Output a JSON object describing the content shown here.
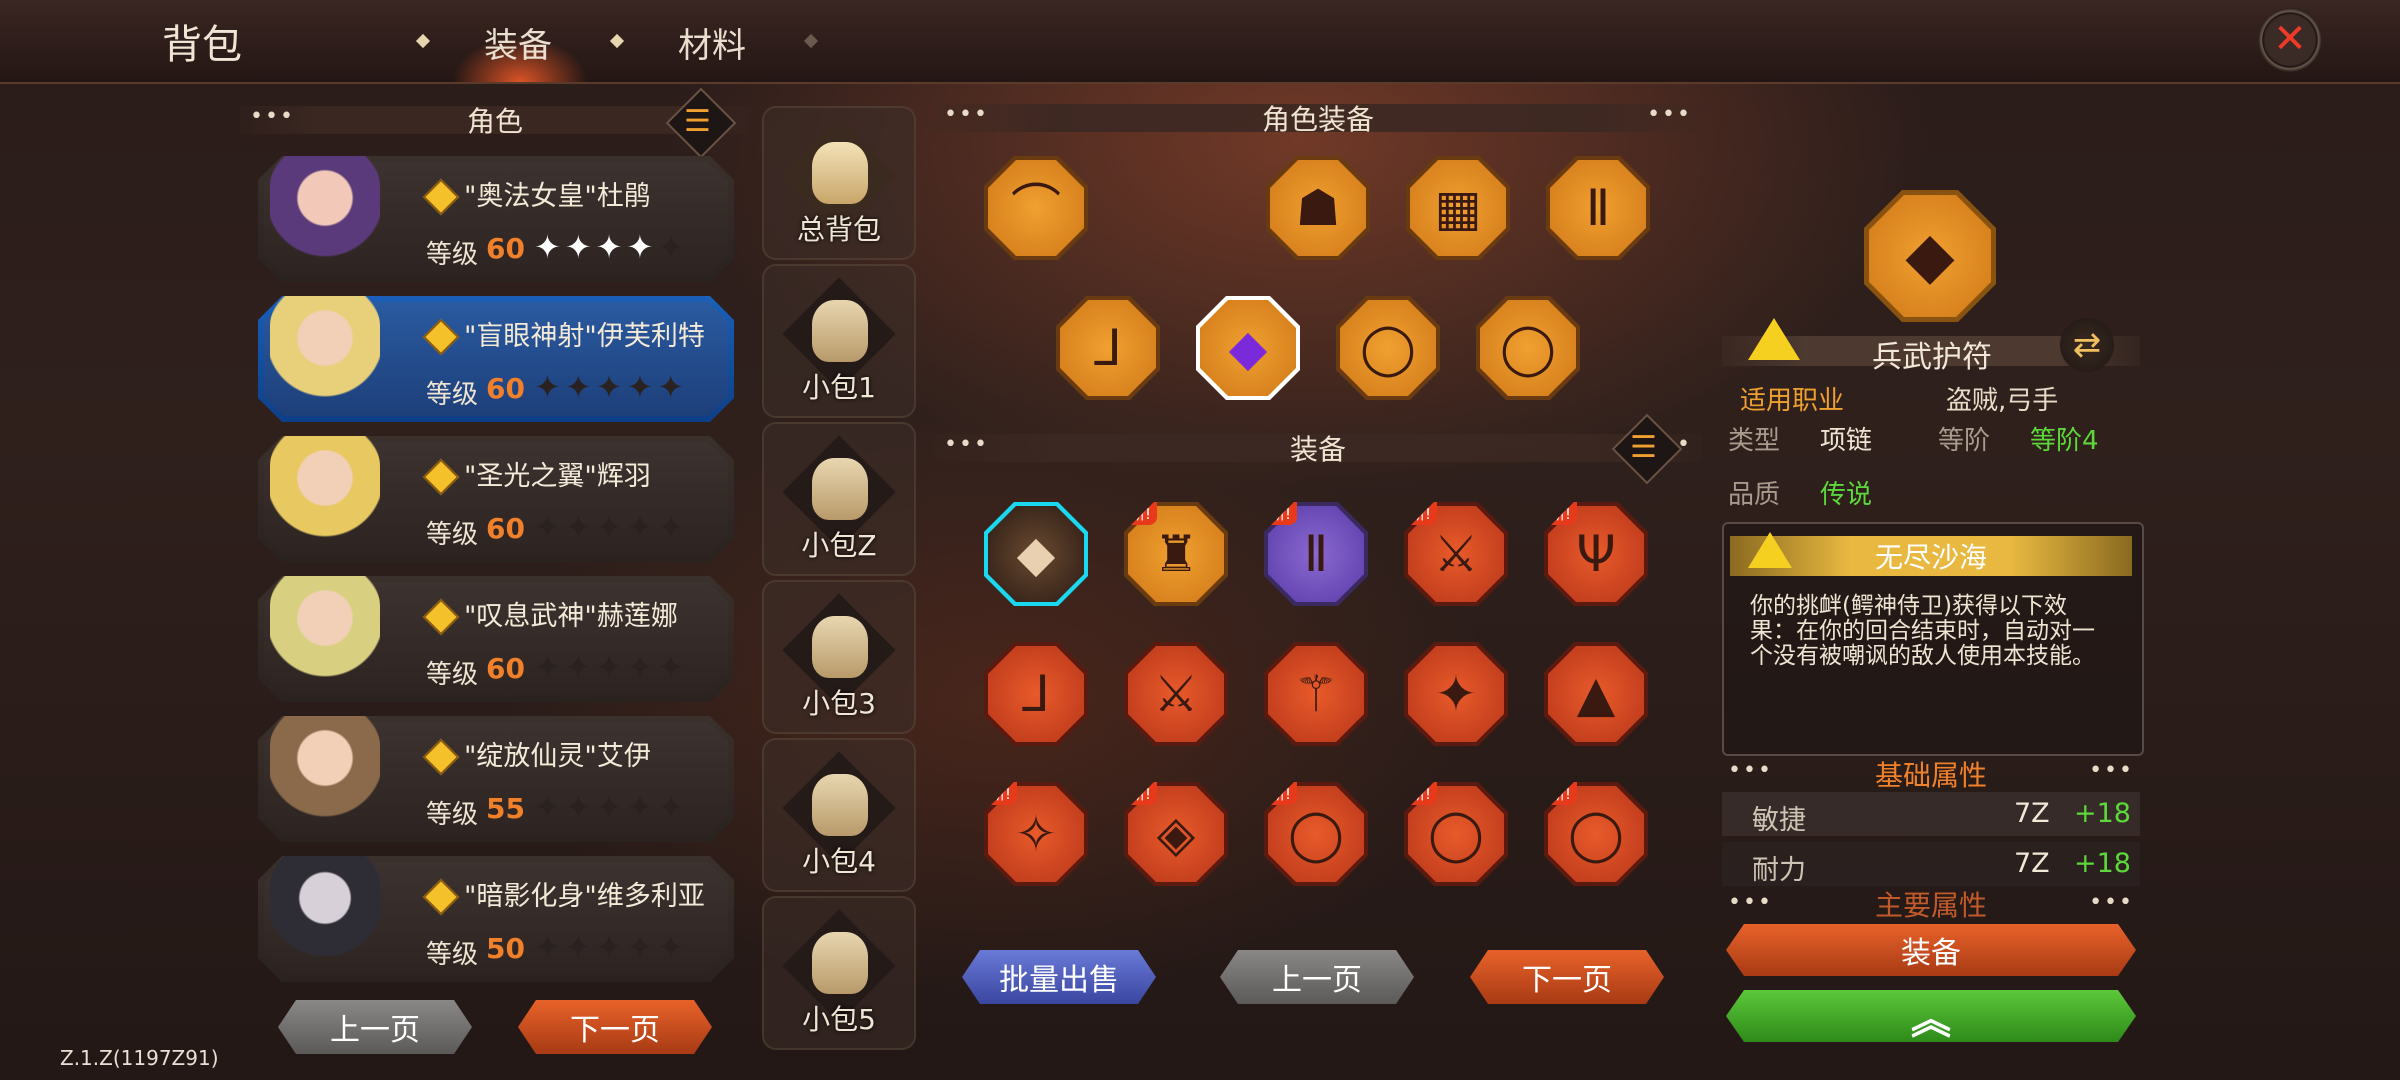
{
  "header": {
    "title": "背包",
    "tabs": [
      {
        "label": "装备",
        "active": true
      },
      {
        "label": "材料",
        "active": false
      }
    ],
    "close_icon": "close-icon"
  },
  "characters": {
    "header": "角色",
    "list": [
      {
        "name": "\"奥法女皇\"杜鹃",
        "level_label": "等级",
        "level": "60",
        "stars_filled": 4,
        "stars_total": 5,
        "selected": false
      },
      {
        "name": "\"盲眼神射\"伊芙利特",
        "level_label": "等级",
        "level": "60",
        "stars_filled": 0,
        "stars_total": 5,
        "selected": true
      },
      {
        "name": "\"圣光之翼\"辉羽",
        "level_label": "等级",
        "level": "60",
        "stars_filled": 0,
        "stars_total": 5,
        "selected": false
      },
      {
        "name": "\"叹息武神\"赫莲娜",
        "level_label": "等级",
        "level": "60",
        "stars_filled": 0,
        "stars_total": 5,
        "selected": false
      },
      {
        "name": "\"绽放仙灵\"艾伊",
        "level_label": "等级",
        "level": "55",
        "stars_filled": 0,
        "stars_total": 5,
        "selected": false
      },
      {
        "name": "\"暗影化身\"维多利亚",
        "level_label": "等级",
        "level": "50",
        "stars_filled": 0,
        "stars_total": 5,
        "selected": false
      }
    ],
    "prev_label": "上一页",
    "next_label": "下一页"
  },
  "bags": [
    {
      "label": "总背包",
      "active": true
    },
    {
      "label": "小包1",
      "active": false
    },
    {
      "label": "小包Z",
      "active": false
    },
    {
      "label": "小包3",
      "active": false
    },
    {
      "label": "小包4",
      "active": false
    },
    {
      "label": "小包5",
      "active": false
    }
  ],
  "equipped": {
    "header": "角色装备",
    "slots": [
      {
        "icon": "bow-icon",
        "glyph": "⌒",
        "style": "gold"
      },
      {
        "icon": "hood-icon",
        "glyph": "☗",
        "style": "gold"
      },
      {
        "icon": "armor-icon",
        "glyph": "▦",
        "style": "gold"
      },
      {
        "icon": "leggings-icon",
        "glyph": "Ⅱ",
        "style": "gold"
      },
      {
        "icon": "boots-icon",
        "glyph": "⅃",
        "style": "gold"
      },
      {
        "icon": "necklace-icon",
        "glyph": "◆",
        "style": "gold",
        "selected": true
      },
      {
        "icon": "ring-icon",
        "glyph": "◯",
        "style": "gold"
      },
      {
        "icon": "ring-icon",
        "glyph": "◯",
        "style": "gold"
      }
    ]
  },
  "inventory": {
    "header": "装备",
    "new_label": "新!",
    "items": [
      {
        "icon": "necklace-icon",
        "glyph": "◆",
        "style": "gold",
        "selected": true,
        "new": false
      },
      {
        "icon": "chest-armor-icon",
        "glyph": "♜",
        "style": "gold",
        "new": true
      },
      {
        "icon": "greaves-icon",
        "glyph": "Ⅱ",
        "style": "purple",
        "new": true
      },
      {
        "icon": "sword-icon",
        "glyph": "⚔",
        "style": "red",
        "new": true
      },
      {
        "icon": "trident-icon",
        "glyph": "Ψ",
        "style": "red",
        "new": true
      },
      {
        "icon": "boots-icon",
        "glyph": "⅃",
        "style": "red",
        "new": false
      },
      {
        "icon": "sword-icon",
        "glyph": "⚔",
        "style": "red",
        "new": false
      },
      {
        "icon": "mace-icon",
        "glyph": "⚚",
        "style": "red",
        "new": false
      },
      {
        "icon": "staff-icon",
        "glyph": "✦",
        "style": "red",
        "new": false
      },
      {
        "icon": "robe-icon",
        "glyph": "▲",
        "style": "red",
        "new": false
      },
      {
        "icon": "wings-icon",
        "glyph": "✧",
        "style": "red",
        "new": true
      },
      {
        "icon": "amulet-icon",
        "glyph": "◈",
        "style": "red",
        "new": true
      },
      {
        "icon": "ring-icon",
        "glyph": "◯",
        "style": "red",
        "new": true
      },
      {
        "icon": "ring-icon",
        "glyph": "◯",
        "style": "red",
        "new": true
      },
      {
        "icon": "ring-icon",
        "glyph": "◯",
        "style": "red",
        "new": true
      }
    ],
    "bulk_sell_label": "批量出售",
    "prev_label": "上一页",
    "next_label": "下一页"
  },
  "detail": {
    "item_name": "兵武护符",
    "class_label": "适用职业",
    "class_value": "盗贼,弓手",
    "type_label": "类型",
    "type_value": "项链",
    "tier_label": "等阶",
    "tier_value": "等阶4",
    "quality_label": "品质",
    "quality_value": "传说",
    "skill_name": "无尽沙海",
    "skill_desc": "你的挑衅(鳄神侍卫)获得以下效果：在你的回合结束时，自动对一个没有被嘲讽的敌人使用本技能。",
    "base_header": "基础属性",
    "stats": [
      {
        "name": "敏捷",
        "value": "7Z",
        "bonus": "+18"
      },
      {
        "name": "耐力",
        "value": "7Z",
        "bonus": "+18"
      }
    ],
    "main_header": "主要属性",
    "equip_label": "装备",
    "upgrade_icon": "chevron-up-icon"
  },
  "version": "Z.1.Z(1197Z91)",
  "colors": {
    "accent_orange": "#f0802a",
    "quality_green": "#5cd83a",
    "class_orange": "#f0a030",
    "selection_blue": "#1a5fb8"
  }
}
